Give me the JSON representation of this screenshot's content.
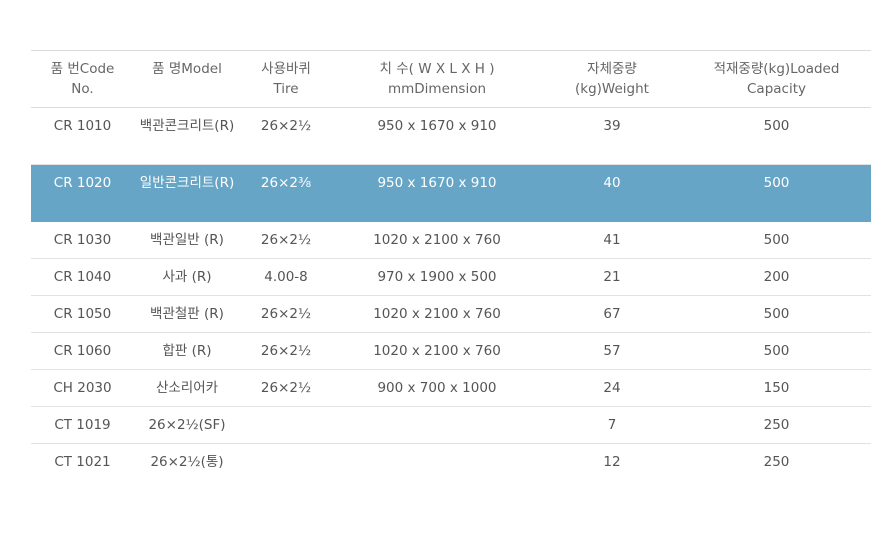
{
  "table": {
    "headers": [
      {
        "line1": "품 번Code",
        "line2": "No."
      },
      {
        "line1": "품 명Model",
        "line2": ""
      },
      {
        "line1": "사용바퀴",
        "line2": "Tire"
      },
      {
        "line1": "치 수( W X L X H )",
        "line2": "mmDimension"
      },
      {
        "line1": "자체중량",
        "line2": "(kg)Weight"
      },
      {
        "line1": "적재중량(kg)Loaded",
        "line2": "Capacity"
      }
    ],
    "rows": [
      {
        "code": "CR 1010",
        "model": "백관콘크리트(R)",
        "tire": "26×2½",
        "dimension": "950 x 1670 x 910",
        "weight": "39",
        "capacity": "500"
      },
      {
        "code": "CR 1020",
        "model": "일반콘크리트(R)",
        "tire": "26×2⅜",
        "dimension": "950 x 1670 x 910",
        "weight": "40",
        "capacity": "500"
      },
      {
        "code": "CR 1030",
        "model": "백관일반 (R)",
        "tire": "26×2½",
        "dimension": "1020 x 2100 x 760",
        "weight": "41",
        "capacity": "500"
      },
      {
        "code": "CR 1040",
        "model": "사과 (R)",
        "tire": "4.00-8",
        "dimension": "970 x 1900 x 500",
        "weight": "21",
        "capacity": "200"
      },
      {
        "code": "CR 1050",
        "model": "백관철판 (R)",
        "tire": "26×2½",
        "dimension": "1020 x 2100 x 760",
        "weight": "67",
        "capacity": "500"
      },
      {
        "code": "CR 1060",
        "model": "합판 (R)",
        "tire": "26×2½",
        "dimension": "1020 x 2100 x 760",
        "weight": "57",
        "capacity": "500"
      },
      {
        "code": "CH 2030",
        "model": "산소리어카",
        "tire": "26×2½",
        "dimension": "900 x 700 x 1000",
        "weight": "24",
        "capacity": "150"
      },
      {
        "code": "CT 1019",
        "model": "26×2½(SF)",
        "tire": "",
        "dimension": "",
        "weight": "7",
        "capacity": "250"
      },
      {
        "code": "CT 1021",
        "model": "26×2½(통)",
        "tire": "",
        "dimension": "",
        "weight": "12",
        "capacity": "250"
      }
    ]
  },
  "colors": {
    "selected_row_bg": "#67a5c6",
    "selected_row_text": "#ffffff",
    "text": "#555555",
    "border": "#e2e2e2"
  }
}
